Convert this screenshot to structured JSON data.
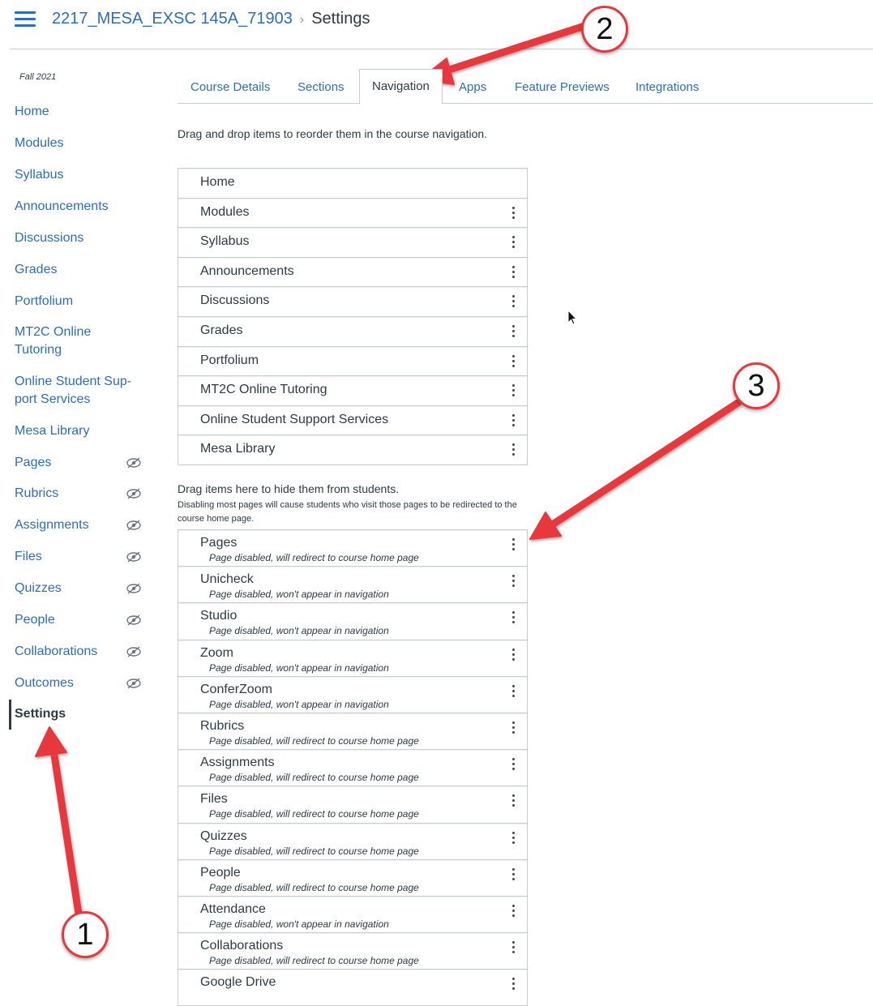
{
  "header": {
    "course": "2217_MESA_EXSC 145A_71903",
    "separator": "›",
    "current": "Settings"
  },
  "sidebar": {
    "term": "Fall 2021",
    "items": [
      {
        "label": "Home"
      },
      {
        "label": "Modules"
      },
      {
        "label": "Syllabus"
      },
      {
        "label": "Announcements"
      },
      {
        "label": "Discussions"
      },
      {
        "label": "Grades"
      },
      {
        "label": "Portfolium"
      },
      {
        "label": "MT2C Online Tutoring"
      },
      {
        "label": "Online Student Sup-port Services"
      },
      {
        "label": "Mesa Library"
      },
      {
        "label": "Pages",
        "hidden_icon": "eye-slash-icon"
      },
      {
        "label": "Rubrics",
        "hidden_icon": "eye-slash-icon"
      },
      {
        "label": "Assignments",
        "hidden_icon": "eye-slash-icon"
      },
      {
        "label": "Files",
        "hidden_icon": "eye-slash-icon"
      },
      {
        "label": "Quizzes",
        "hidden_icon": "eye-slash-icon"
      },
      {
        "label": "People",
        "hidden_icon": "eye-slash-icon"
      },
      {
        "label": "Collaborations",
        "hidden_icon": "eye-slash-icon"
      },
      {
        "label": "Outcomes",
        "hidden_icon": "eye-slash-icon"
      },
      {
        "label": "Settings",
        "active": true
      }
    ]
  },
  "tabs": [
    {
      "label": "Course Details"
    },
    {
      "label": "Sections"
    },
    {
      "label": "Navigation",
      "active": true
    },
    {
      "label": "Apps"
    },
    {
      "label": "Feature Previews"
    },
    {
      "label": "Integrations"
    }
  ],
  "navigation": {
    "instructions": "Drag and drop items to reorder them in the course navigation.",
    "enabled": [
      {
        "label": "Home"
      },
      {
        "label": "Modules"
      },
      {
        "label": "Syllabus"
      },
      {
        "label": "Announcements"
      },
      {
        "label": "Discussions"
      },
      {
        "label": "Grades"
      },
      {
        "label": "Portfolium"
      },
      {
        "label": "MT2C Online Tutoring"
      },
      {
        "label": "Online Student Support Services"
      },
      {
        "label": "Mesa Library"
      }
    ],
    "hidden_title": "Drag items here to hide them from students.",
    "hidden_note": "Disabling most pages will cause students who visit those pages to be redirected to the course home page.",
    "hidden": [
      {
        "label": "Pages",
        "sub": "Page disabled, will redirect to course home page"
      },
      {
        "label": "Unicheck",
        "sub": "Page disabled, won't appear in navigation"
      },
      {
        "label": "Studio",
        "sub": "Page disabled, won't appear in navigation"
      },
      {
        "label": "Zoom",
        "sub": "Page disabled, won't appear in navigation"
      },
      {
        "label": "ConferZoom",
        "sub": "Page disabled, won't appear in navigation"
      },
      {
        "label": "Rubrics",
        "sub": "Page disabled, will redirect to course home page"
      },
      {
        "label": "Assignments",
        "sub": "Page disabled, will redirect to course home page"
      },
      {
        "label": "Files",
        "sub": "Page disabled, will redirect to course home page"
      },
      {
        "label": "Quizzes",
        "sub": "Page disabled, will redirect to course home page"
      },
      {
        "label": "People",
        "sub": "Page disabled, will redirect to course home page"
      },
      {
        "label": "Attendance",
        "sub": "Page disabled, won't appear in navigation"
      },
      {
        "label": "Collaborations",
        "sub": "Page disabled, will redirect to course home page"
      },
      {
        "label": "Google Drive",
        "sub": ""
      }
    ]
  },
  "annotations": {
    "callout_1": "1",
    "callout_2": "2",
    "callout_3": "3",
    "color": "#e8383d"
  },
  "colors": {
    "link": "#2d6dbf",
    "text": "#2d3b45",
    "border": "#c7cdd1"
  }
}
